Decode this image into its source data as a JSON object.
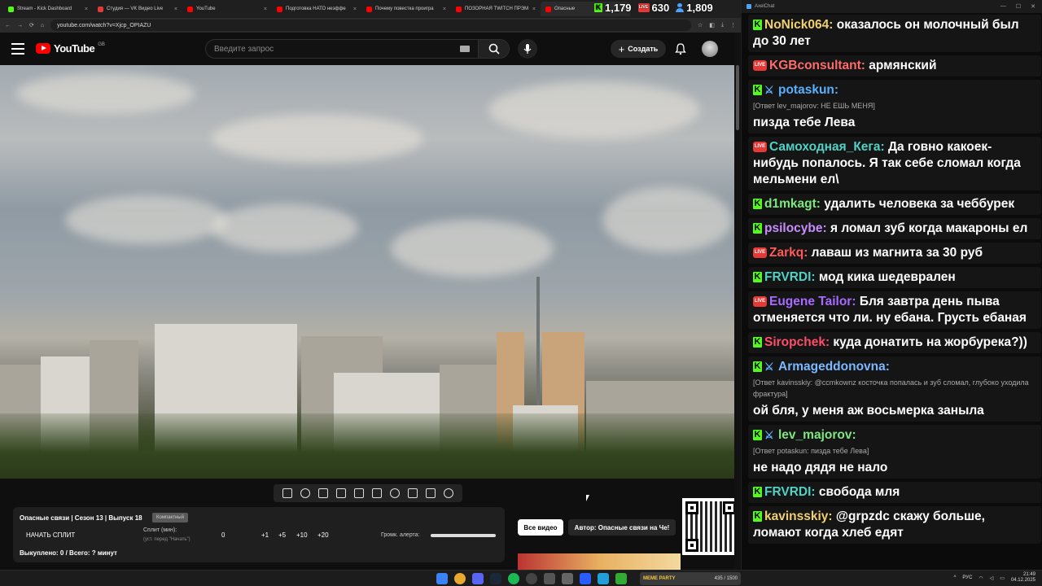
{
  "browser": {
    "tabs": [
      {
        "label": "Stream - Kick Dashboard",
        "color": "#53fc18"
      },
      {
        "label": "Студия — VK Видео Live",
        "color": "#e53935"
      },
      {
        "label": "YouTube",
        "color": "#ff0000"
      },
      {
        "label": "Подготовка НАТО неэффе",
        "color": "#ff0000"
      },
      {
        "label": "Почему повестка проигра",
        "color": "#ff0000"
      },
      {
        "label": "ПОЗОРНАЯ TWITCH ПРЭМ",
        "color": "#ff0000"
      },
      {
        "label": "Опасные",
        "color": "#ff0000"
      }
    ],
    "url": "youtube.com/watch?v=Xjcp_OPIAZU"
  },
  "overlay": {
    "kick_viewers": "1,179",
    "vk_viewers": "630",
    "total_viewers": "1,809",
    "vk_badge": "LIVE"
  },
  "youtube": {
    "logo_text": "YouTube",
    "logo_country": "GB",
    "search_placeholder": "Введите запрос",
    "create_label": "Создать"
  },
  "split_panel": {
    "title": "Опасные связи | Сезон 13 | Выпуск 18",
    "badge": "Компактный",
    "start_label": "НАЧАТЬ СПЛИТ",
    "split_label": "Сплит (мин):",
    "split_sub": "(уст. перед \"Начать\")",
    "zero": "0",
    "inc1": "+1",
    "inc5": "+5",
    "inc10": "+10",
    "inc20": "+20",
    "alert_label": "Громк. алерта:",
    "alert_volume": 1.0,
    "bought": "Выкуплено: 0 / Всего: ? минут"
  },
  "all_videos_label": "Все видео",
  "author_label": "Автор: Опасные связи на Че!",
  "chat": {
    "window_title": "AxelChat",
    "messages": [
      {
        "platform": "kick",
        "user": "NoNick064:",
        "color": "#f0d070",
        "text": " оказалось он молочный был до 30 лет"
      },
      {
        "platform": "vk",
        "user": "KGBconsultant:",
        "color": "#ff6a6a",
        "text": " армянский"
      },
      {
        "platform": "kick",
        "mod": true,
        "user": "potaskun:",
        "color": "#5ab0ff",
        "reply": "[Ответ lev_majorov: НЕ ЕШЬ МЕНЯ]",
        "text": "пизда тебе Лева"
      },
      {
        "platform": "vk",
        "user": "Самоходная_Кега:",
        "color": "#4fd1c5",
        "text": " Да говно какоек-нибудь попалось. Я так себе сломал когда мельмени ел\\"
      },
      {
        "platform": "kick",
        "user": "d1mkagt:",
        "color": "#7ee87e",
        "text": " удалить человека за чеббурек"
      },
      {
        "platform": "kick",
        "user": "psilocybe:",
        "color": "#c98cff",
        "text": " я ломал зуб когда макароны ел"
      },
      {
        "platform": "vk",
        "user": "Zarkq:",
        "color": "#ff5a5a",
        "text": " лаваш из магнита за 30 руб"
      },
      {
        "platform": "kick",
        "user": "FRVRDI:",
        "color": "#4fd1c5",
        "text": " мод кика шедеврален"
      },
      {
        "platform": "vk",
        "user": "Eugene Tailor:",
        "color": "#a86bff",
        "text": " Бля завтра день пыва отменяется что ли. ну ебана. Грусть ебаная"
      },
      {
        "platform": "kick",
        "user": "Siropchek:",
        "color": "#ff4d6a",
        "text": " куда донатить на жорбурека?))"
      },
      {
        "platform": "kick",
        "mod": true,
        "user": "Armageddonovna:",
        "color": "#7ab8ff",
        "reply": "[Ответ kavinsskiy: @ccmkownz косточка попалась и зуб сломал, глубоко уходила фрактура]",
        "text": "ой бля, у меня аж восьмерка заныла"
      },
      {
        "platform": "kick",
        "mod": true,
        "user": "lev_majorov:",
        "color": "#7ee87e",
        "reply": "[Ответ potaskun: пизда тебе Лева]",
        "text": "не надо дядя не нало"
      },
      {
        "platform": "kick",
        "user": "FRVRDI:",
        "color": "#4fd1c5",
        "text": " свобода мля"
      },
      {
        "platform": "kick",
        "user": "kavinsskiy:",
        "color": "#f0d070",
        "text": " @grpzdc скажу больше, ломают когда хлеб едят"
      }
    ]
  },
  "taskbar": {
    "media_label": "MEME PARTY",
    "media_counter": "435 / 1500",
    "lang": "РУС",
    "time": "21:49",
    "date": "04.12.2025"
  }
}
